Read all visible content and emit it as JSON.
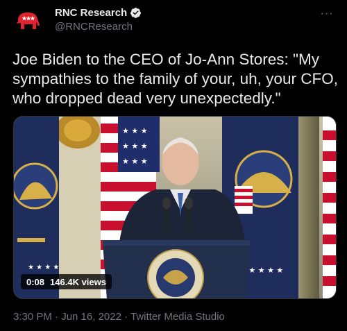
{
  "author": {
    "display_name": "RNC Research",
    "handle": "@RNCResearch",
    "avatar_icon": "gop-elephant-icon",
    "verified_icon": "verified-badge-icon"
  },
  "tweet": {
    "text": "Joe Biden to the CEO of Jo-Ann Stores: \"My sympathies to the family of your, uh, your CFO, who dropped dead very unexpectedly.\""
  },
  "video": {
    "duration": "0:08",
    "views": "146.4K views"
  },
  "meta": {
    "timestamp": "3:30 PM · Jun 16, 2022 · Twitter Media Studio"
  },
  "colors": {
    "background": "#000000",
    "text": "#e7e9ea",
    "muted": "#71767b",
    "brand_red": "#e0242f",
    "verified_blue": "#e7e9ea"
  }
}
